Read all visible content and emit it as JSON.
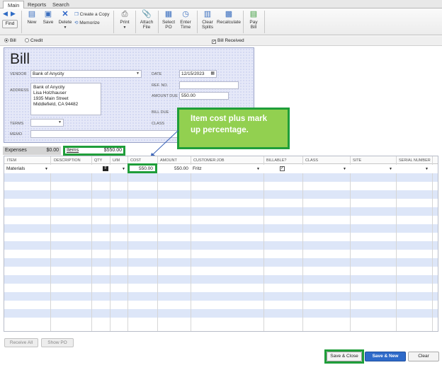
{
  "tabs": [
    "Main",
    "Reports",
    "Search"
  ],
  "toolbar": {
    "find": "Find",
    "new": "New",
    "save": "Save",
    "delete": "Delete",
    "create_copy": "Create a Copy",
    "memorize": "Memorize",
    "print": "Print",
    "attach_file": [
      "Attach",
      "File"
    ],
    "select_po": [
      "Select",
      "PO"
    ],
    "enter_time": [
      "Enter",
      "Time"
    ],
    "clear_splits": [
      "Clear",
      "Splits"
    ],
    "recalculate": "Recalculate",
    "pay_bill": [
      "Pay",
      "Bill"
    ]
  },
  "type": {
    "bill": "Bill",
    "credit": "Credit",
    "bill_received": "Bill Received"
  },
  "form": {
    "title": "Bill",
    "vendor_label": "VENDOR",
    "vendor": "Bank of Anycity",
    "address_label": "ADDRESS",
    "address": [
      "Bank of Anycity",
      "Lisa Holzhauser",
      "1935 Main Street",
      "Middlefield, CA 94482"
    ],
    "date_label": "DATE",
    "date": "12/15/2023",
    "ref_label": "REF. NO.",
    "amount_due_label": "AMOUNT DUE",
    "amount_due": "550.00",
    "bill_due_label": "BILL DUE",
    "terms_label": "TERMS",
    "class_label": "CLASS",
    "memo_label": "MEMO"
  },
  "callout": [
    "Item cost plus mark",
    "up percentage."
  ],
  "subtabs": {
    "expenses": "Expenses",
    "expenses_amt": "$0.00",
    "items": "Items",
    "items_amt": "$550.00"
  },
  "columns": [
    "ITEM",
    "DESCRIPTION",
    "QTY",
    "U/M",
    "COST",
    "AMOUNT",
    "CUSTOMER:JOB",
    "BILLABLE?",
    "CLASS",
    "SITE",
    "SERIAL NUMBER"
  ],
  "line": {
    "item": "Materials",
    "cost": "550.00",
    "amount": "550.00",
    "customer": "Fritz",
    "billable": "✓"
  },
  "bottom": {
    "receive_all": "Receive All",
    "show_po": "Show PO"
  },
  "footer": {
    "save_close": "Save & Close",
    "save_new": "Save & New",
    "clear": "Clear"
  }
}
